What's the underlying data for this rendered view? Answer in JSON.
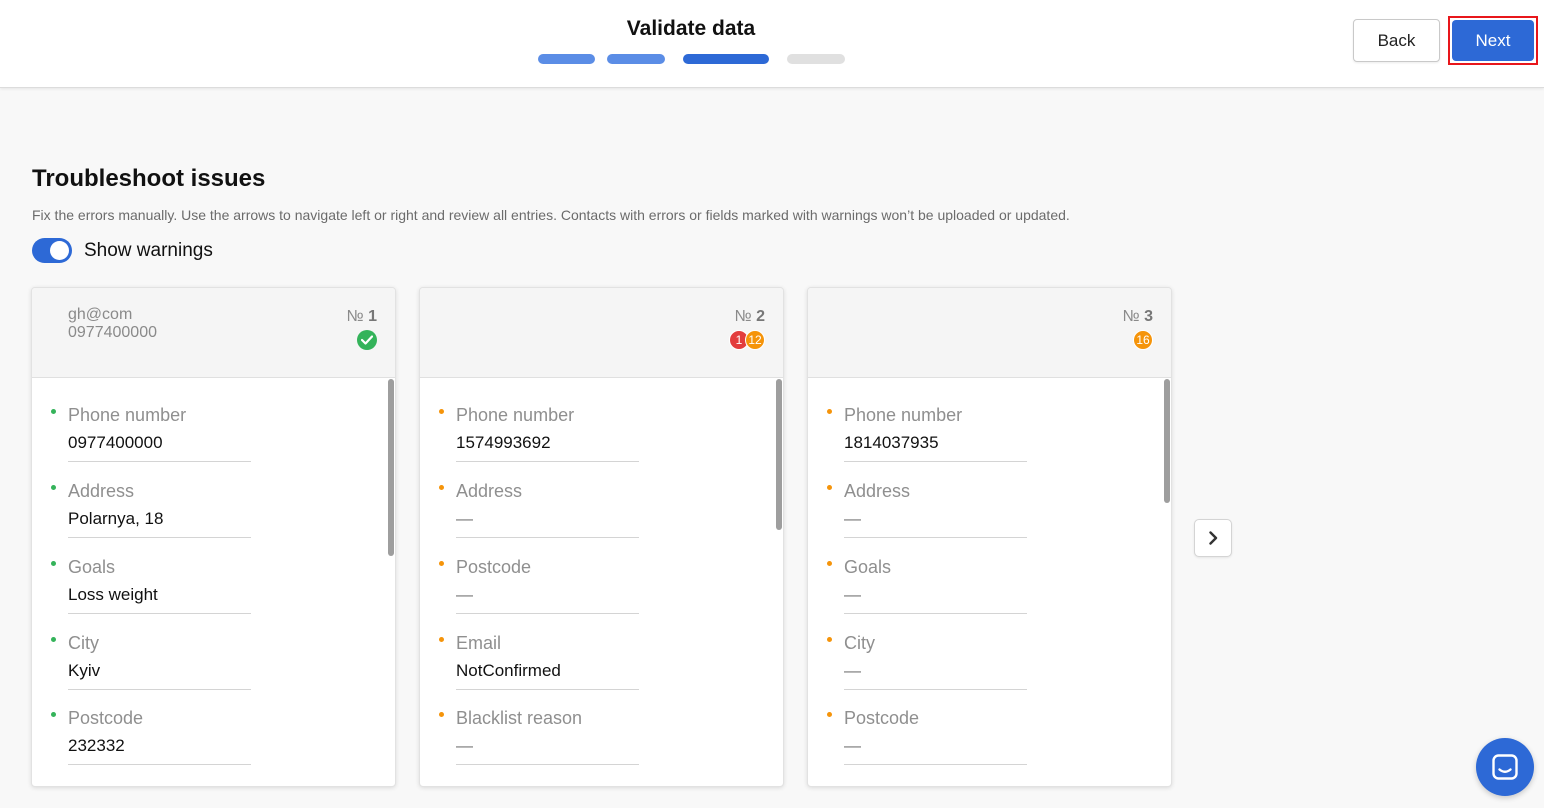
{
  "colors": {
    "accent": "#2d69d6",
    "step_light": "#5b8de6",
    "step_dark": "#2d69d6",
    "step_inactive": "#e0e0e0",
    "ok": "#34b35a",
    "warning": "#f5940a",
    "error": "#e33d3d"
  },
  "header": {
    "title": "Validate data",
    "steps": [
      "complete",
      "complete",
      "current",
      "pending"
    ],
    "back_label": "Back",
    "next_label": "Next"
  },
  "section": {
    "title": "Troubleshoot issues",
    "description": "Fix the errors manually. Use the arrows to navigate left or right and review all entries. Contacts with errors or fields marked with warnings won’t be uploaded or updated.",
    "toggle_label": "Show warnings",
    "toggle_on": true
  },
  "cards": [
    {
      "number_prefix": "№",
      "number": "1",
      "subtitle_lines": [
        "gh@com",
        "0977400000"
      ],
      "status": "ok",
      "errors": null,
      "warnings": null,
      "fields": [
        {
          "label": "Phone number",
          "value": "0977400000",
          "status": "ok"
        },
        {
          "label": "Address",
          "value": "Polarnya, 18",
          "status": "ok"
        },
        {
          "label": "Goals",
          "value": "Loss weight",
          "status": "ok"
        },
        {
          "label": "City",
          "value": "Kyiv",
          "status": "ok"
        },
        {
          "label": "Postcode",
          "value": "232332",
          "status": "ok"
        }
      ]
    },
    {
      "number_prefix": "№",
      "number": "2",
      "subtitle_lines": [],
      "status": "issues",
      "errors": "1",
      "warnings": "12",
      "fields": [
        {
          "label": "Phone number",
          "value": "1574993692",
          "status": "warning"
        },
        {
          "label": "Address",
          "value": "—",
          "status": "warning"
        },
        {
          "label": "Postcode",
          "value": "—",
          "status": "warning"
        },
        {
          "label": "Email",
          "value": "NotConfirmed",
          "status": "warning"
        },
        {
          "label": "Blacklist reason",
          "value": "—",
          "status": "warning"
        }
      ]
    },
    {
      "number_prefix": "№",
      "number": "3",
      "subtitle_lines": [],
      "status": "issues",
      "errors": null,
      "warnings": "16",
      "fields": [
        {
          "label": "Phone number",
          "value": "1814037935",
          "status": "warning"
        },
        {
          "label": "Address",
          "value": "—",
          "status": "warning"
        },
        {
          "label": "Goals",
          "value": "—",
          "status": "warning"
        },
        {
          "label": "City",
          "value": "—",
          "status": "warning"
        },
        {
          "label": "Postcode",
          "value": "—",
          "status": "warning"
        }
      ]
    }
  ],
  "navigation": {
    "next_icon": "chevron-right-icon"
  },
  "chat": {
    "icon": "chat-bubble-icon"
  }
}
